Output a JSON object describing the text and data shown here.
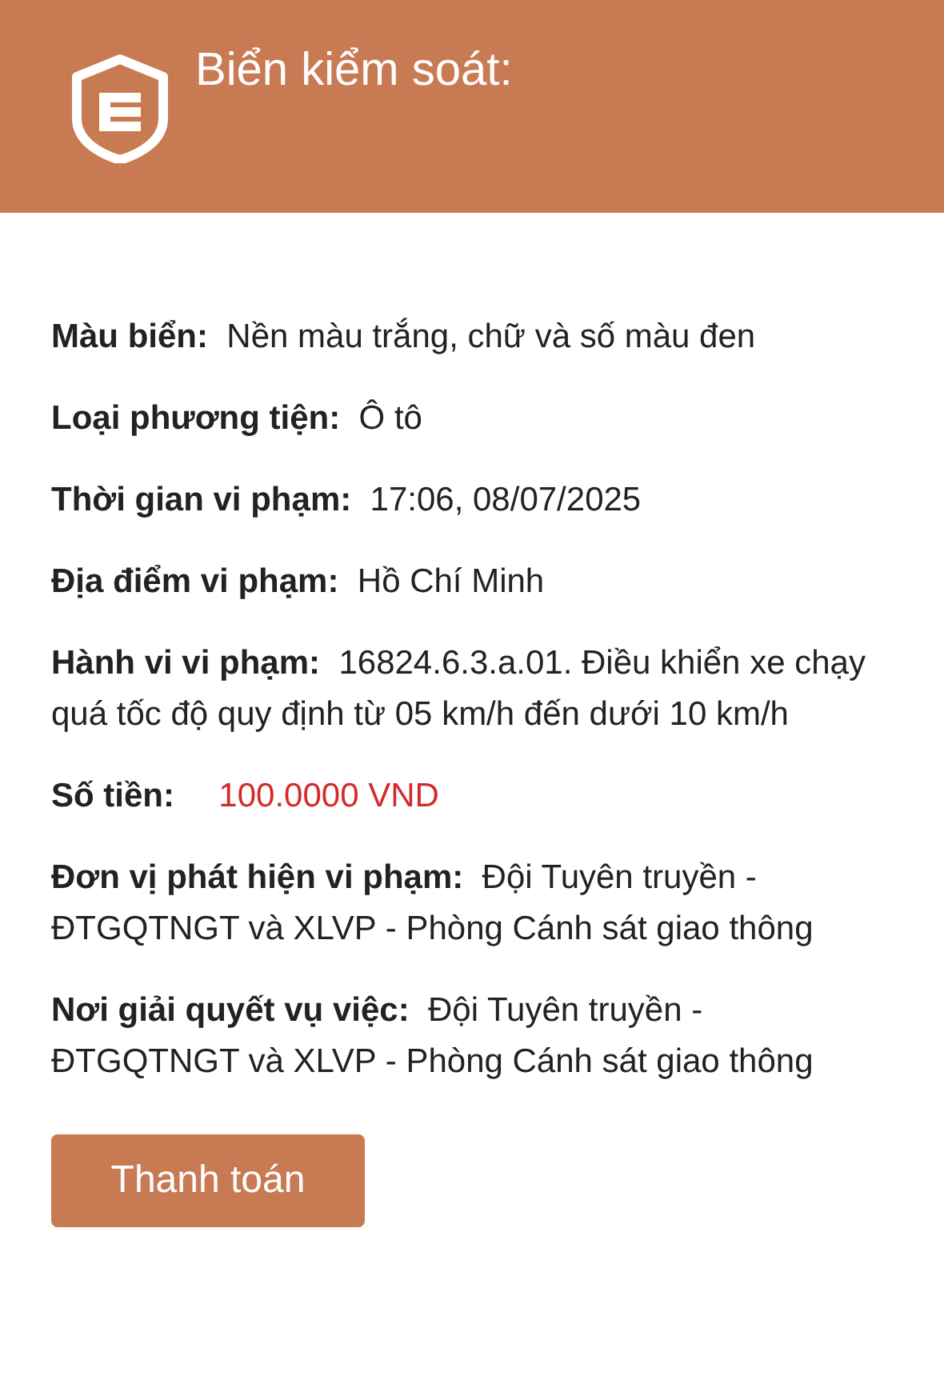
{
  "header": {
    "title": "Biển kiểm soát:"
  },
  "fields": [
    {
      "label": "Màu biển:",
      "value": "Nền màu trắng, chữ và số màu đen",
      "kind": "text"
    },
    {
      "label": "Loại phương tiện:",
      "value": "Ô tô",
      "kind": "text"
    },
    {
      "label": "Thời gian vi phạm:",
      "value": "17:06, 08/07/2025",
      "kind": "text"
    },
    {
      "label": "Địa điểm vi phạm:",
      "value": "Hồ Chí Minh",
      "kind": "text"
    },
    {
      "label": "Hành vi vi phạm:",
      "value": "16824.6.3.a.01. Điều khiển xe chạy quá tốc độ quy định từ 05 km/h đến dưới 10 km/h",
      "kind": "text"
    },
    {
      "label": "Số tiền:",
      "value": "100.0000 VND",
      "kind": "amount"
    },
    {
      "label": "Đơn vị phát hiện vi phạm:",
      "value": "Đội Tuyên truyền - ĐTGQTNGT và XLVP - Phòng Cánh sát giao thông",
      "kind": "text"
    },
    {
      "label": "Nơi giải quyết vụ việc:",
      "value": "Đội Tuyên truyền - ĐTGQTNGT và XLVP - Phòng Cánh sát giao thông",
      "kind": "text"
    }
  ],
  "button": {
    "label": "Thanh toán"
  }
}
